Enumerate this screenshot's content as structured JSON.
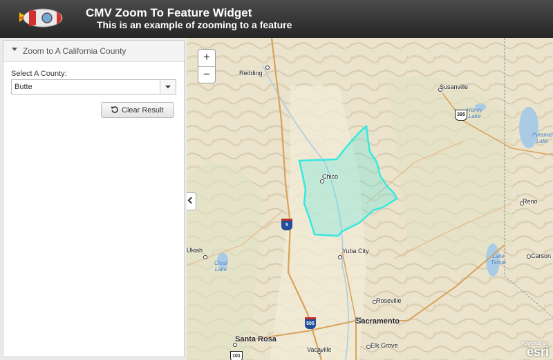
{
  "header": {
    "title": "CMV Zoom To Feature Widget",
    "subtitle": "This is an example of zooming to a feature"
  },
  "panel": {
    "title": "Zoom to A California County",
    "select_label": "Select A County:",
    "selected_county": "Butte",
    "clear_button": "Clear Result"
  },
  "map": {
    "zoom_in": "+",
    "zoom_out": "−",
    "highlight_color": "#38e8e0",
    "cities": {
      "redding": "Redding",
      "susanville": "Susanville",
      "chico": "Chico",
      "reno": "Reno",
      "ukiah": "Ukiah",
      "yuba_city": "Yuba City",
      "carson": "Carson",
      "roseville": "Roseville",
      "sacramento": "Sacramento",
      "santa_rosa": "Santa Rosa",
      "vacaville": "Vacaville",
      "elk_grove": "Elk Grove"
    },
    "water": {
      "honey_lake": "Honey\nLake",
      "pyramid_lake": "Pyramid\nLake",
      "clear_lake": "Clear\nLake",
      "lake_tahoe": "Lake\nTahoe"
    },
    "shields": {
      "i5": "5",
      "i505": "505",
      "us395": "395",
      "us101": "101"
    },
    "attribution": {
      "powered": "POWERED BY",
      "brand": "esri"
    }
  }
}
